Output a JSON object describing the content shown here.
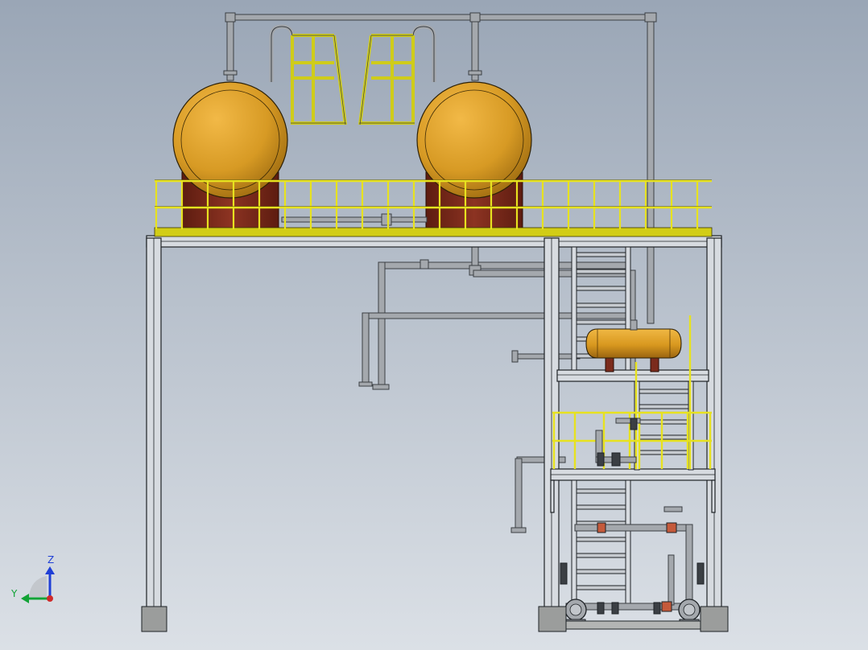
{
  "scene": {
    "description_kind": "3D CAD front view of a steel skid structure",
    "background_colors": [
      "#9aa6b6",
      "#dbe0e6"
    ],
    "steel_color": "#d7dbe0",
    "steel_edge_color": "#1e2226",
    "pipe_color": "#a4a8ad",
    "railing_color": "#e7e21f",
    "tank_color": "#d79a24",
    "saddle_color": "#7b2b1c",
    "foundation_color": "#9b9d9c"
  },
  "triad": {
    "z_label": "Z",
    "y_label": "Y",
    "z_color": "#1f3fd6",
    "y_color": "#12a336",
    "origin_color": "#cf2a2a"
  },
  "components": {
    "spherical_tanks": 2,
    "horizontal_vessel": 1,
    "pumps": 2,
    "stair_flights": 3,
    "platform_levels": 3,
    "foundations": 3
  }
}
